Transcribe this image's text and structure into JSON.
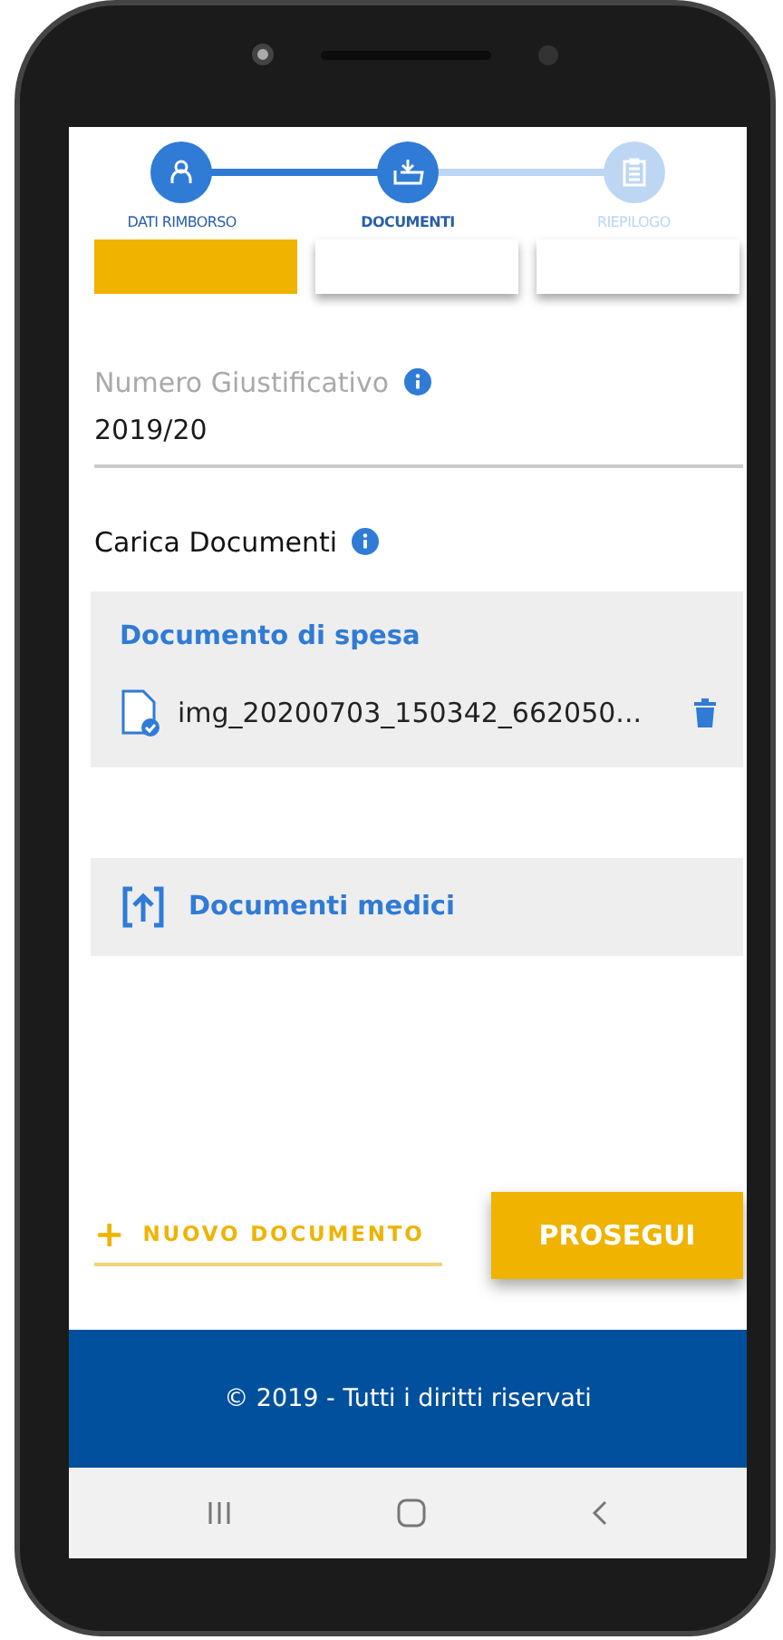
{
  "steps": [
    {
      "label": "DATI RIMBORSO",
      "kind": "person",
      "completed": true,
      "selected": false
    },
    {
      "label": "DOCUMENTI",
      "kind": "download",
      "completed": false,
      "selected": true
    },
    {
      "label": "RIEPILOGO",
      "kind": "clipboard",
      "completed": false,
      "selected": false
    }
  ],
  "option_cards": [
    {
      "kind": "primary"
    },
    {
      "kind": "plain"
    },
    {
      "kind": "plain"
    }
  ],
  "numero_field": {
    "label": "Numero Giustificativo",
    "value": "2019/20"
  },
  "upload_section": {
    "title": "Carica Documenti"
  },
  "documents": [
    {
      "kind": "uploaded",
      "title": "Documento di spesa",
      "files": [
        {
          "name": "img_20200703_150342_662050..."
        }
      ]
    },
    {
      "kind": "empty",
      "title": "Documenti medici"
    }
  ],
  "actions": {
    "add_icon": "+",
    "add_label": "NUOVO DOCUMENTO",
    "next_label": "PROSEGUI"
  },
  "footer": {
    "text": "© 2019 - Tutti i diritti riservati"
  },
  "nav_bar": [
    {
      "kind": "recents"
    },
    {
      "kind": "home"
    },
    {
      "kind": "back"
    }
  ]
}
